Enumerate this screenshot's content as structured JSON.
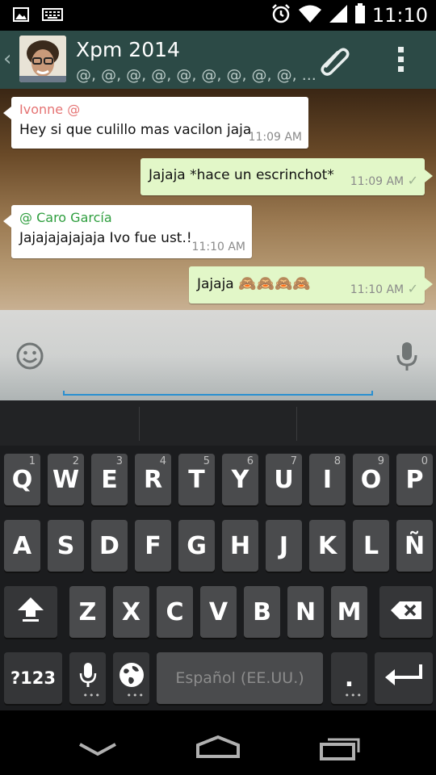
{
  "status_bar": {
    "time": "11:10",
    "icons": [
      "image-icon",
      "keyboard-icon",
      "alarm-icon",
      "wifi-icon",
      "signal-icon",
      "battery-icon"
    ]
  },
  "header": {
    "back_icon": "chevron-left-icon",
    "title": "Xpm 2014",
    "subtitle": "@, @, @, @, @, @, @, @, @, ...",
    "attach_icon": "paperclip-icon",
    "menu_icon": "more-vertical-icon",
    "color": "#2c4a46"
  },
  "messages": [
    {
      "direction": "in",
      "sender": "Ivonne @",
      "sender_color": "#e57373",
      "text": "Hey si que culillo mas vacilon jaja",
      "time": "11:09 AM"
    },
    {
      "direction": "out",
      "text": "Jajaja *hace un escrinchot*",
      "time": "11:09 AM",
      "status": "✓"
    },
    {
      "direction": "in",
      "sender": "@ Caro García",
      "sender_color": "#2e9e3e",
      "text": "Jajajajajajaja Ivo fue ust.!",
      "time": "11:10 AM"
    },
    {
      "direction": "out",
      "text": "Jajaja",
      "emoji": "🙈🙈🙈🙈",
      "time": "11:10 AM",
      "status": "✓"
    }
  ],
  "composer": {
    "emoji_icon": "smiley-icon",
    "mic_icon": "microphone-icon",
    "value": "",
    "placeholder": ""
  },
  "keyboard": {
    "row1": [
      {
        "label": "Q",
        "hint": "1"
      },
      {
        "label": "W",
        "hint": "2"
      },
      {
        "label": "E",
        "hint": "3"
      },
      {
        "label": "R",
        "hint": "4"
      },
      {
        "label": "T",
        "hint": "5"
      },
      {
        "label": "Y",
        "hint": "6"
      },
      {
        "label": "U",
        "hint": "7"
      },
      {
        "label": "I",
        "hint": "8"
      },
      {
        "label": "O",
        "hint": "9"
      },
      {
        "label": "P",
        "hint": "0"
      }
    ],
    "row2": [
      "A",
      "S",
      "D",
      "F",
      "G",
      "H",
      "J",
      "K",
      "L",
      "Ñ"
    ],
    "row3": [
      "Z",
      "X",
      "C",
      "V",
      "B",
      "N",
      "M"
    ],
    "symbols": "?123",
    "space": "Español (EE.UU.)",
    "period": ".",
    "shift_icon": "shift-arrow-icon",
    "backspace_icon": "backspace-icon",
    "enter_icon": "enter-arrow-icon",
    "mic_icon": "microphone-icon",
    "globe_icon": "globe-icon"
  },
  "nav_bar": {
    "back_icon": "nav-back-icon",
    "home_icon": "nav-home-icon",
    "recents_icon": "nav-recents-icon"
  }
}
